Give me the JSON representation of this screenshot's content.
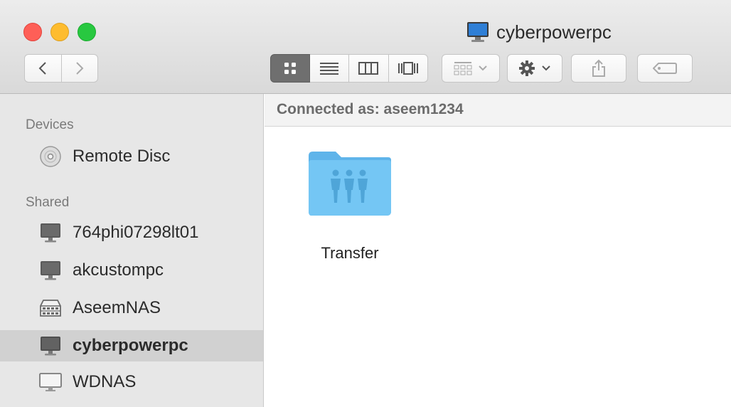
{
  "window": {
    "title": "cyberpowerpc",
    "title_icon": "computer-icon"
  },
  "toolbar": {
    "back_icon": "chevron-left-icon",
    "forward_icon": "chevron-right-icon",
    "view_modes": [
      "icon-view-icon",
      "list-view-icon",
      "column-view-icon",
      "cover-flow-icon"
    ],
    "selected_view": "icon-view-icon",
    "arrange_icon": "arrange-icon",
    "action_icon": "gear-icon",
    "share_icon": "share-icon",
    "tag_icon": "tag-icon"
  },
  "sidebar": {
    "devices_heading": "Devices",
    "devices": [
      {
        "label": "Remote Disc",
        "icon": "disc-icon"
      }
    ],
    "shared_heading": "Shared",
    "shared": [
      {
        "label": "764phi07298lt01",
        "icon": "computer-icon"
      },
      {
        "label": "akcustompc",
        "icon": "computer-icon"
      },
      {
        "label": "AseemNAS",
        "icon": "nas-icon"
      },
      {
        "label": "cyberpowerpc",
        "icon": "computer-icon",
        "selected": true
      },
      {
        "label": "WDNAS",
        "icon": "display-icon"
      }
    ]
  },
  "pathbar": {
    "connected_text": "Connected as: aseem1234"
  },
  "content": {
    "items": [
      {
        "label": "Transfer",
        "icon": "shared-folder-icon"
      }
    ]
  },
  "colors": {
    "folder": "#6ec1f2",
    "sidebar_bg": "#e7e7e7",
    "selection": "#d1d1d1"
  }
}
